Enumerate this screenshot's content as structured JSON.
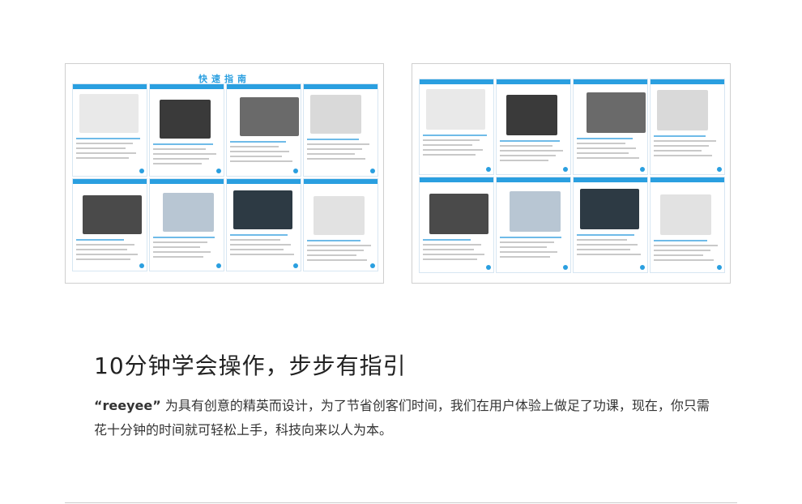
{
  "brochures": {
    "left_title": "快速指南"
  },
  "content": {
    "headline": "10分钟学会操作，步步有指引",
    "brand": "“reeyee”",
    "description": "为具有创意的精英而设计，为了节省创客们时间，我们在用户体验上做足了功课，现在，你只需花十分钟的时间就可轻松上手，科技向来以人为本。"
  }
}
